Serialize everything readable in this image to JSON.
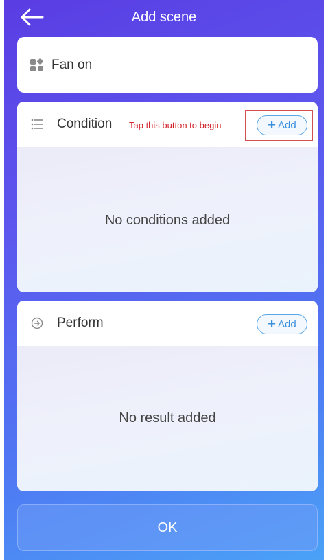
{
  "header": {
    "title": "Add scene",
    "back_icon": "arrow-left-icon"
  },
  "scene_name": {
    "icon": "scene-grid-icon",
    "value": "Fan on"
  },
  "condition": {
    "icon": "list-icon",
    "title": "Condition",
    "hint": "Tap this button to begin",
    "add_label": "Add",
    "add_icon": "plus-icon",
    "empty_text": "No conditions added"
  },
  "perform": {
    "icon": "arrow-right-circle-icon",
    "title": "Perform",
    "add_label": "Add",
    "add_icon": "plus-icon",
    "empty_text": "No result added"
  },
  "ok_label": "OK",
  "colors": {
    "accent_blue": "#3b8fdc",
    "hint_red": "#d2232a",
    "bg_start": "#5a3de3",
    "bg_end": "#4aa2f6"
  }
}
